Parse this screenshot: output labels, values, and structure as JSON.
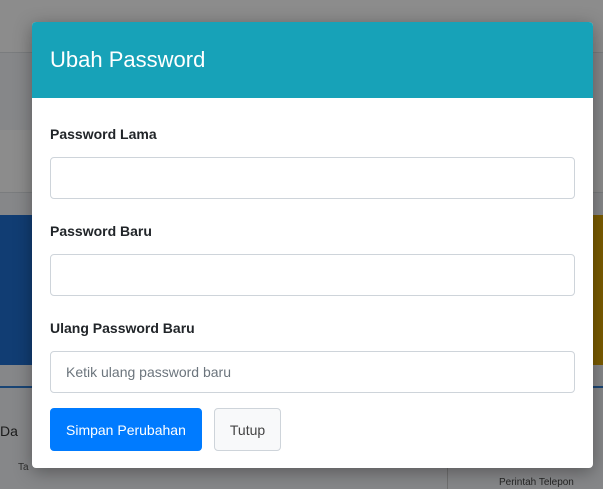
{
  "background": {
    "fragment_left": "Da",
    "fragment_left_sub": "Ta",
    "fragment_right": "Perintah Telepon"
  },
  "modal": {
    "title": "Ubah Password",
    "header_color": "#17a2b8",
    "fields": [
      {
        "label": "Password Lama",
        "value": "",
        "placeholder": ""
      },
      {
        "label": "Password Baru",
        "value": "",
        "placeholder": ""
      },
      {
        "label": "Ulang Password Baru",
        "value": "",
        "placeholder": "Ketik ulang password baru"
      }
    ],
    "buttons": {
      "save_label": "Simpan Perubahan",
      "close_label": "Tutup"
    }
  }
}
